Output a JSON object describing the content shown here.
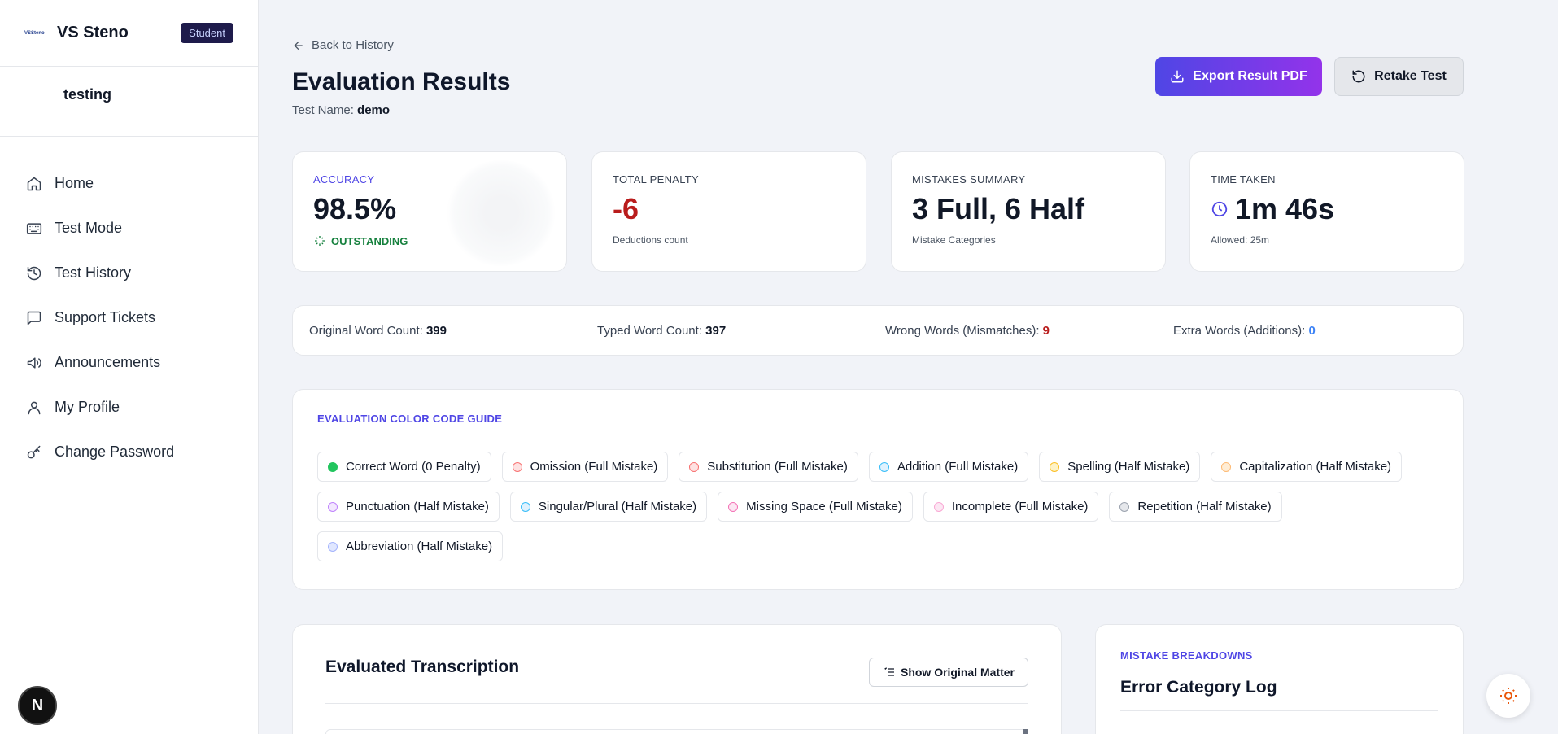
{
  "brand": {
    "logo_text": "VSSteno",
    "name": "VS Steno",
    "role": "Student"
  },
  "user": {
    "name": "testing"
  },
  "nav": [
    {
      "label": "Home",
      "icon": "home-icon"
    },
    {
      "label": "Test Mode",
      "icon": "keyboard-icon"
    },
    {
      "label": "Test History",
      "icon": "history-icon"
    },
    {
      "label": "Support Tickets",
      "icon": "message-icon"
    },
    {
      "label": "Announcements",
      "icon": "megaphone-icon"
    },
    {
      "label": "My Profile",
      "icon": "user-icon"
    },
    {
      "label": "Change Password",
      "icon": "key-icon"
    }
  ],
  "next_badge": "N",
  "header": {
    "back_label": "Back to History",
    "title": "Evaluation Results",
    "test_name_label": "Test Name:",
    "test_name": "demo",
    "export_label": "Export Result PDF",
    "retake_label": "Retake Test"
  },
  "stats": {
    "accuracy": {
      "label": "ACCURACY",
      "value": "98.5%",
      "sub": "OUTSTANDING"
    },
    "penalty": {
      "label": "TOTAL PENALTY",
      "value": "-6",
      "sub": "Deductions count"
    },
    "mistakes": {
      "label": "MISTAKES SUMMARY",
      "value": "3 Full, 6 Half",
      "sub": "Mistake Categories"
    },
    "time": {
      "label": "TIME TAKEN",
      "value": "1m 46s",
      "sub": "Allowed: 25m"
    }
  },
  "counts": {
    "original_label": "Original Word Count:",
    "original": "399",
    "typed_label": "Typed Word Count:",
    "typed": "397",
    "wrong_label": "Wrong Words (Mismatches):",
    "wrong": "9",
    "extra_label": "Extra Words (Additions):",
    "extra": "0"
  },
  "guide": {
    "title": "EVALUATION COLOR CODE GUIDE",
    "items": [
      {
        "label": "Correct Word (0 Penalty)",
        "fill": "#22c55e",
        "border": "#22c55e"
      },
      {
        "label": "Omission (Full Mistake)",
        "fill": "#fee2e2",
        "border": "#f87171"
      },
      {
        "label": "Substitution (Full Mistake)",
        "fill": "#fee2e2",
        "border": "#f87171"
      },
      {
        "label": "Addition (Full Mistake)",
        "fill": "#e0f2fe",
        "border": "#38bdf8"
      },
      {
        "label": "Spelling (Half Mistake)",
        "fill": "#fef3c7",
        "border": "#fbbf24"
      },
      {
        "label": "Capitalization (Half Mistake)",
        "fill": "#ffedd5",
        "border": "#fdba74"
      },
      {
        "label": "Punctuation (Half Mistake)",
        "fill": "#f3e8ff",
        "border": "#c084fc"
      },
      {
        "label": "Singular/Plural (Half Mistake)",
        "fill": "#e0f2fe",
        "border": "#38bdf8"
      },
      {
        "label": "Missing Space (Full Mistake)",
        "fill": "#fce7f3",
        "border": "#f472b6"
      },
      {
        "label": "Incomplete (Full Mistake)",
        "fill": "#fce7f3",
        "border": "#f9a8d4"
      },
      {
        "label": "Repetition (Half Mistake)",
        "fill": "#e5e7eb",
        "border": "#9ca3af"
      },
      {
        "label": "Abbreviation (Half Mistake)",
        "fill": "#e0e7ff",
        "border": "#a5b4fc"
      }
    ]
  },
  "transcription": {
    "title": "Evaluated Transcription",
    "show_original_label": "Show Original Matter"
  },
  "breakdown": {
    "label": "MISTAKE BREAKDOWNS",
    "title": "Error Category Log"
  },
  "colors": {
    "accent": "#4f46e5",
    "danger": "#b91c1c",
    "success": "#15803d",
    "info": "#3b82f6"
  }
}
